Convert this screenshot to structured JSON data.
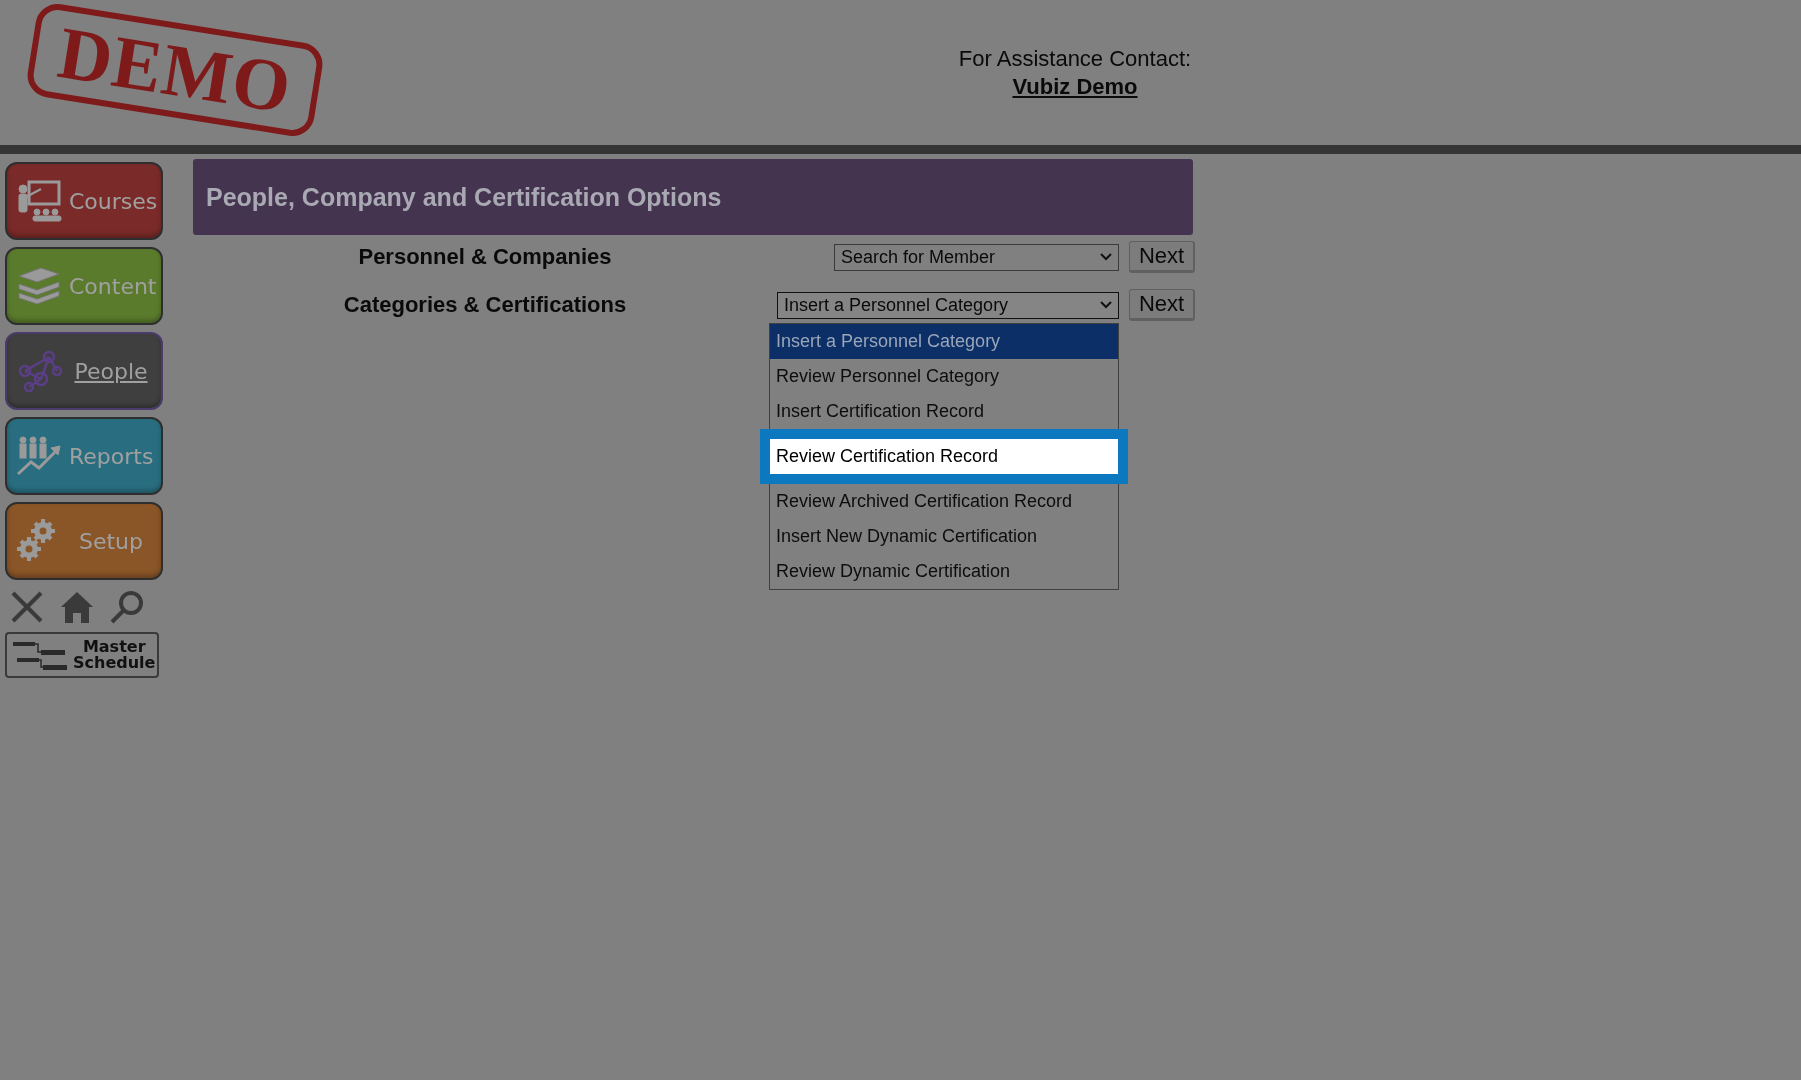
{
  "logo": {
    "text": "DEMO"
  },
  "assistance": {
    "label": "For Assistance Contact:",
    "link": "Vubiz Demo"
  },
  "sidebar": {
    "items": [
      {
        "label": "Courses",
        "kind": "courses",
        "selected": false
      },
      {
        "label": "Content",
        "kind": "content",
        "selected": false
      },
      {
        "label": "People",
        "kind": "people",
        "selected": true
      },
      {
        "label": "Reports",
        "kind": "reports",
        "selected": false
      },
      {
        "label": "Setup",
        "kind": "setup",
        "selected": false
      }
    ],
    "tools": [
      {
        "kind": "close"
      },
      {
        "kind": "home"
      },
      {
        "kind": "search"
      }
    ],
    "master_schedule": {
      "lines": [
        "Master",
        "Schedule"
      ]
    }
  },
  "panel": {
    "title": "People, Company and Certification Options",
    "rows": [
      {
        "label": "Personnel & Companies",
        "select": {
          "value": "Search for Member",
          "expanded": false
        },
        "button": "Next"
      },
      {
        "label": "Categories & Certifications",
        "select": {
          "value": "Insert a Personnel Category",
          "expanded": true,
          "options": [
            {
              "label": "Insert a Personnel Category",
              "selected": true,
              "highlighted": false
            },
            {
              "label": "Review Personnel Category",
              "selected": false,
              "highlighted": false
            },
            {
              "label": "Insert Certification Record",
              "selected": false,
              "highlighted": false
            },
            {
              "label": "Review Certification Record",
              "selected": false,
              "highlighted": true
            },
            {
              "label": "Review Archived Certification Record",
              "selected": false,
              "highlighted": false
            },
            {
              "label": "Insert New Dynamic Certification",
              "selected": false,
              "highlighted": false
            },
            {
              "label": "Review Dynamic Certification",
              "selected": false,
              "highlighted": false
            }
          ]
        },
        "button": "Next"
      }
    ]
  }
}
